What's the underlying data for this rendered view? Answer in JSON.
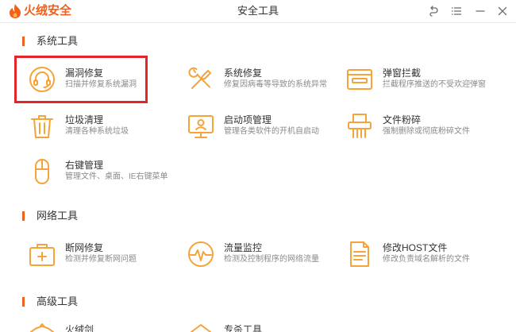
{
  "app": {
    "brand": "火绒安全",
    "title": "安全工具",
    "logo_icon": "huorong-flame-logo-icon"
  },
  "window_controls": [
    {
      "icon": "back-icon"
    },
    {
      "icon": "menu-icon"
    },
    {
      "icon": "minimize-icon"
    },
    {
      "icon": "close-icon"
    }
  ],
  "colors": {
    "brand": "#f0621c",
    "section_bar": "#f0621c",
    "tool_icon": "#f6a33a",
    "highlight_border": "#e3262c",
    "title_text": "#333333",
    "desc_text": "#8a8a8a"
  },
  "sections": [
    {
      "title": "系统工具",
      "tools": [
        {
          "name": "漏洞修复",
          "desc": "扫描并修复系统漏洞",
          "icon": "vulnerability-fix-icon",
          "highlighted": true
        },
        {
          "name": "系统修复",
          "desc": "修复因病毒等导致的系统异常",
          "icon": "wrench-screwdriver-icon"
        },
        {
          "name": "弹窗拦截",
          "desc": "拦截程序推送的不受欢迎弹窗",
          "icon": "popup-window-icon"
        },
        {
          "name": "垃圾清理",
          "desc": "清理各种系统垃圾",
          "icon": "trash-can-icon"
        },
        {
          "name": "启动项管理",
          "desc": "管理各类软件的开机自启动",
          "icon": "monitor-startup-icon"
        },
        {
          "name": "文件粉碎",
          "desc": "强制删除或彻底粉碎文件",
          "icon": "file-shredder-icon"
        },
        {
          "name": "右键管理",
          "desc": "管理文件、桌面、IE右键菜单",
          "icon": "mouse-icon"
        }
      ]
    },
    {
      "title": "网络工具",
      "tools": [
        {
          "name": "断网修复",
          "desc": "检测并修复断网问题",
          "icon": "network-repair-kit-icon"
        },
        {
          "name": "流量监控",
          "desc": "检测及控制程序的网络流量",
          "icon": "traffic-pulse-icon"
        },
        {
          "name": "修改HOST文件",
          "desc": "修改负责域名解析的文件",
          "icon": "host-file-document-icon"
        }
      ]
    },
    {
      "title": "高级工具",
      "tools": [
        {
          "name": "火绒剑",
          "icon": "huorong-sword-icon"
        },
        {
          "name": "专杀工具",
          "icon": "virus-killer-icon"
        }
      ]
    }
  ]
}
